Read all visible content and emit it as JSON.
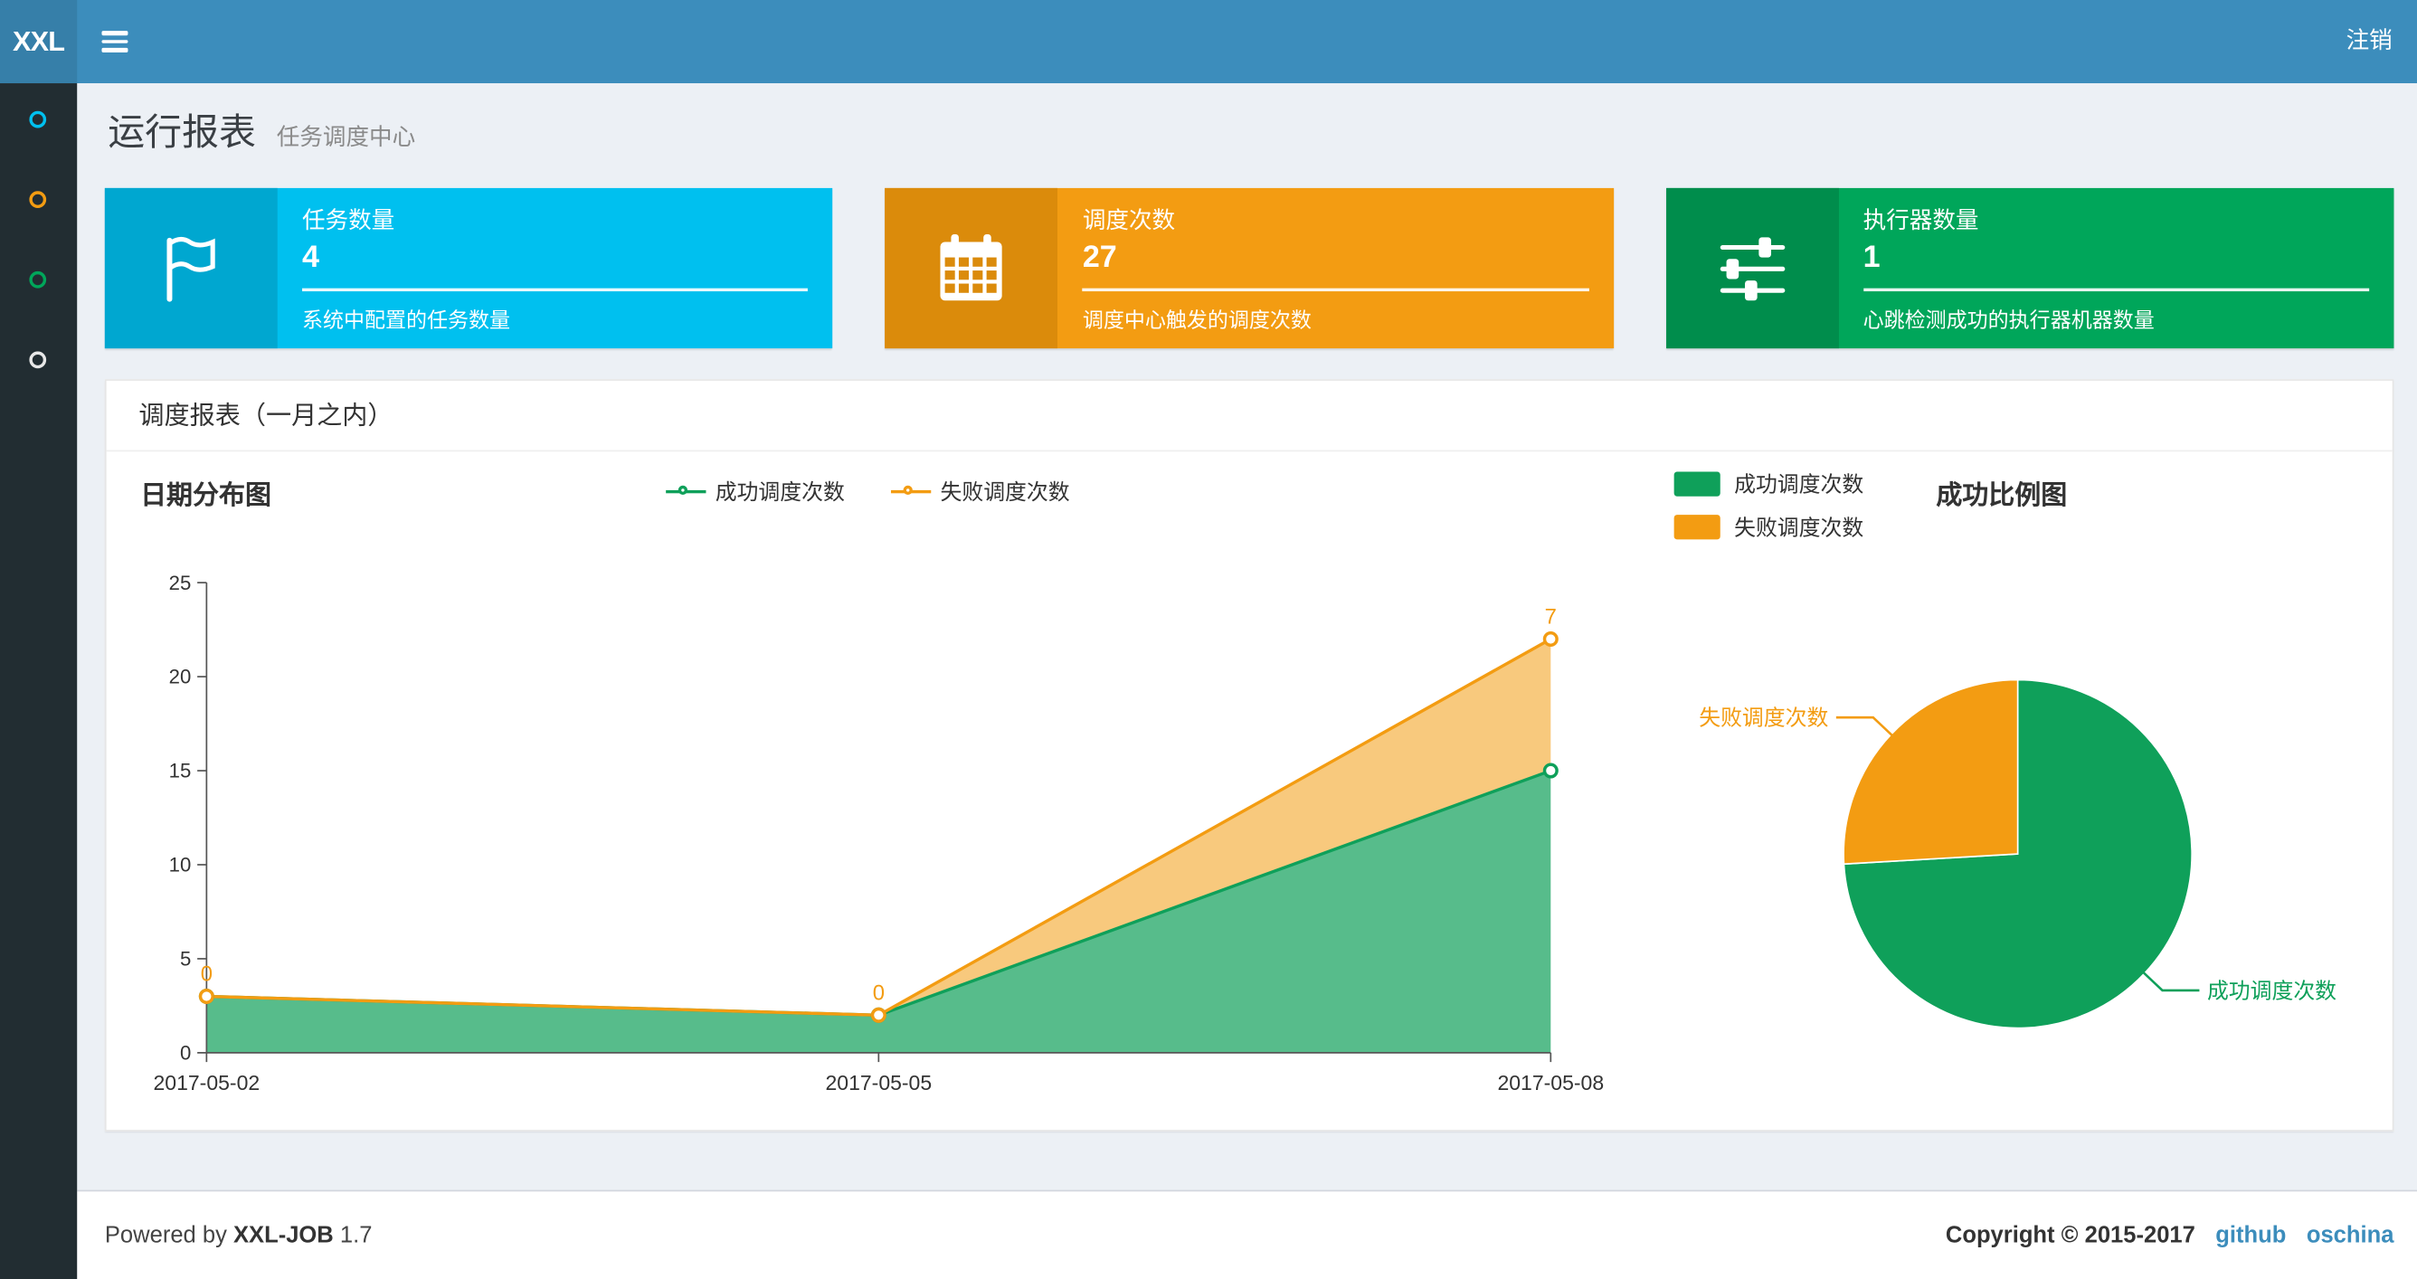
{
  "navbar": {
    "logo": "XXL",
    "logout_label": "注销",
    "bg_color": "#3c8dbc",
    "logo_bg_color": "#367fa9"
  },
  "sidebar": {
    "bg_color": "#222d32",
    "items": [
      {
        "name": "menu-item-1",
        "color": "#00c0ef"
      },
      {
        "name": "menu-item-2",
        "color": "#f39c12"
      },
      {
        "name": "menu-item-3",
        "color": "#00a65a"
      },
      {
        "name": "menu-item-4",
        "color": "#e8e8e8"
      }
    ]
  },
  "page_header": {
    "title": "运行报表",
    "subtitle": "任务调度中心"
  },
  "info_boxes": [
    {
      "icon": "flag-icon",
      "label": "任务数量",
      "value": "4",
      "desc": "系统中配置的任务数量",
      "bg": "#00c0ef",
      "icon_bg": "#00a7d0"
    },
    {
      "icon": "calendar-icon",
      "label": "调度次数",
      "value": "27",
      "desc": "调度中心触发的调度次数",
      "bg": "#f39c12",
      "icon_bg": "#db8b0b"
    },
    {
      "icon": "sliders-icon",
      "label": "执行器数量",
      "value": "1",
      "desc": "心跳检测成功的执行器机器数量",
      "bg": "#00a65a",
      "icon_bg": "#008d4c"
    }
  ],
  "panel": {
    "title": "调度报表（一月之内）"
  },
  "chart_data": [
    {
      "type": "area",
      "title": "日期分布图",
      "stacked": true,
      "grid": false,
      "legend_position": "top-center",
      "categories": [
        "2017-05-02",
        "2017-05-05",
        "2017-05-08"
      ],
      "series": [
        {
          "name": "成功调度次数",
          "values": [
            3,
            2,
            15
          ],
          "color": "#0fa05a"
        },
        {
          "name": "失败调度次数",
          "values": [
            0,
            0,
            7
          ],
          "color": "#f39c12"
        }
      ],
      "value_labels_series": "失败调度次数",
      "ylim": [
        0,
        25
      ],
      "yticks": [
        0,
        5,
        10,
        15,
        20,
        25
      ]
    },
    {
      "type": "pie",
      "title": "成功比例图",
      "legend_position": "top-left",
      "slices": [
        {
          "name": "成功调度次数",
          "value": 20,
          "color": "#0fa05a"
        },
        {
          "name": "失败调度次数",
          "value": 7,
          "color": "#f39c12"
        }
      ]
    }
  ],
  "footer": {
    "powered_by_prefix": "Powered by",
    "product": "XXL-JOB",
    "version": "1.7",
    "copyright": "Copyright © 2015-2017",
    "links": [
      {
        "label": "github"
      },
      {
        "label": "oschina"
      }
    ]
  }
}
